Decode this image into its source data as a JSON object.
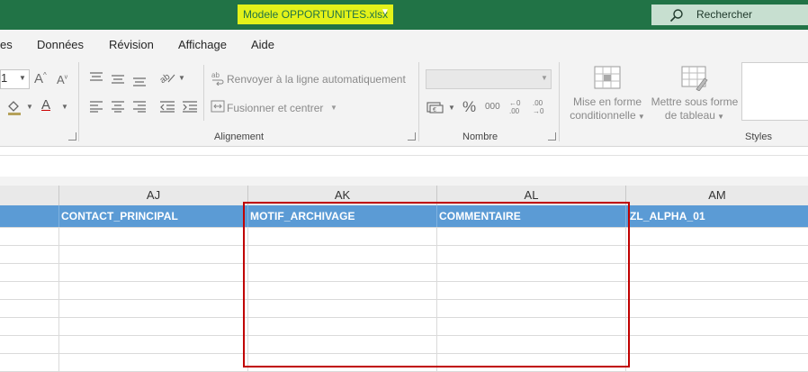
{
  "titlebar": {
    "file_name": "Modele OPPORTUNITES.xlsx",
    "dropdown_icon": "caret-down-icon",
    "search_placeholder": "Rechercher",
    "colors": {
      "bar": "#217346",
      "file_highlight": "#e3f21a",
      "search_bg": "#c7dfd0"
    }
  },
  "menu": {
    "items": [
      "es",
      "Données",
      "Révision",
      "Affichage",
      "Aide"
    ]
  },
  "ribbon": {
    "font": {
      "size_value": "1",
      "grow_label": "A",
      "shrink_label": "A",
      "color_label": "A"
    },
    "alignment": {
      "wrap_text": "Renvoyer à la ligne automatiquement",
      "merge_center": "Fusionner et centrer",
      "group_label": "Alignement"
    },
    "number": {
      "format_value": "",
      "percent": "%",
      "thousands": "000",
      "increase_decimal": "←0 .00",
      "decrease_decimal": ".00 →0",
      "group_label": "Nombre"
    },
    "styles": {
      "conditional_line1": "Mise en forme",
      "conditional_line2": "conditionnelle",
      "table_line1": "Mettre sous forme",
      "table_line2": "de tableau",
      "group_label": "Styles"
    }
  },
  "sheet": {
    "columns": [
      "AJ",
      "AK",
      "AL",
      "AM"
    ],
    "header_row": [
      "CONTACT_PRINCIPAL",
      "MOTIF_ARCHIVAGE",
      "COMMENTAIRE",
      "ZL_ALPHA_01"
    ],
    "colors": {
      "header_fill": "#5b9bd5",
      "selection_border": "#c00000"
    }
  }
}
